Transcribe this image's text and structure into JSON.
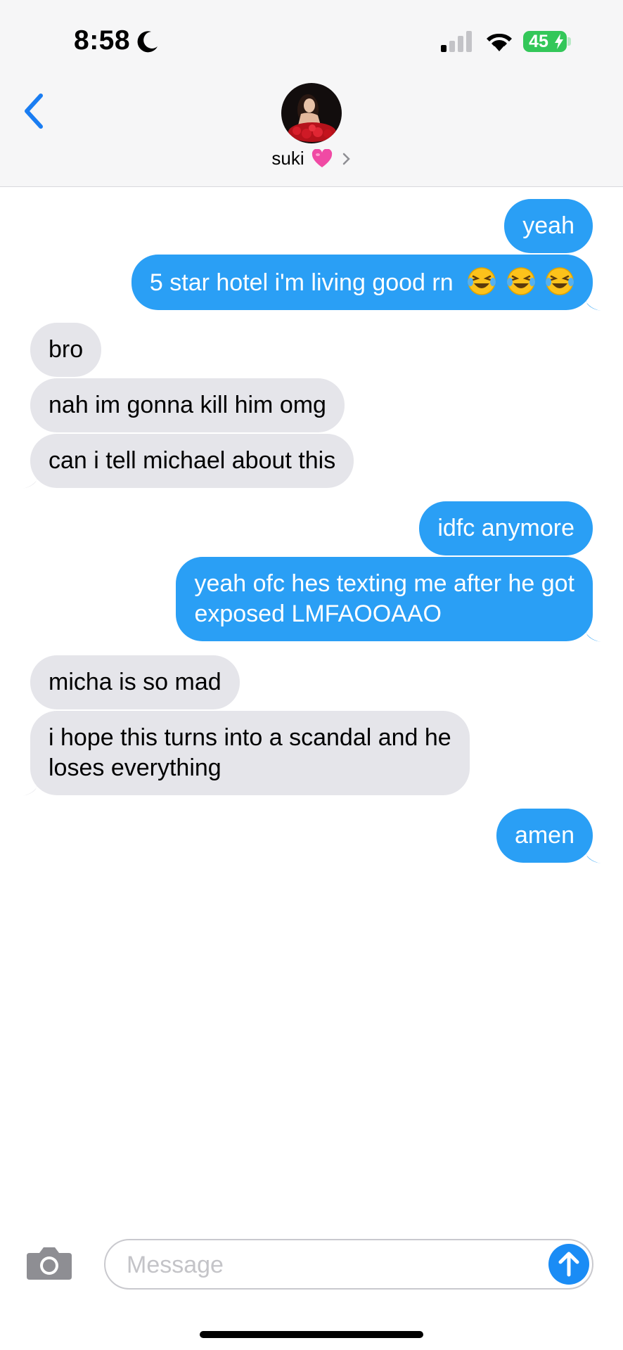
{
  "status_bar": {
    "time": "8:58",
    "battery_level": "45"
  },
  "header": {
    "contact_name": "suki"
  },
  "messages": [
    {
      "from": "me",
      "text": "yeah"
    },
    {
      "from": "me",
      "text": "5 star hotel i'm living good rn",
      "emoji": [
        "face-with-tears-of-joy",
        "face-with-tears-of-joy",
        "face-with-tears-of-joy"
      ]
    },
    {
      "from": "them",
      "text": "bro"
    },
    {
      "from": "them",
      "text": "nah im gonna kill him omg"
    },
    {
      "from": "them",
      "text": "can i tell michael about this"
    },
    {
      "from": "me",
      "text": "idfc anymore"
    },
    {
      "from": "me",
      "line1": "yeah ofc hes texting me after he got",
      "line2": "exposed LMFAOOAAO"
    },
    {
      "from": "them",
      "text": "micha is so mad"
    },
    {
      "from": "them",
      "line1": "i hope this turns into a scandal and he",
      "line2": "loses everything"
    },
    {
      "from": "me",
      "text": "amen"
    }
  ],
  "composer": {
    "placeholder": "Message"
  },
  "colors": {
    "outgoing": "#2a9ff5",
    "incoming": "#e5e5ea",
    "accent": "#1a8cf5",
    "battery": "#33c759"
  },
  "icons": [
    "moon-icon",
    "cellular-signal-icon",
    "wifi-icon",
    "battery-icon",
    "back-chevron-icon",
    "heart-emoji",
    "chevron-right-icon",
    "camera-icon",
    "send-arrow-icon"
  ]
}
